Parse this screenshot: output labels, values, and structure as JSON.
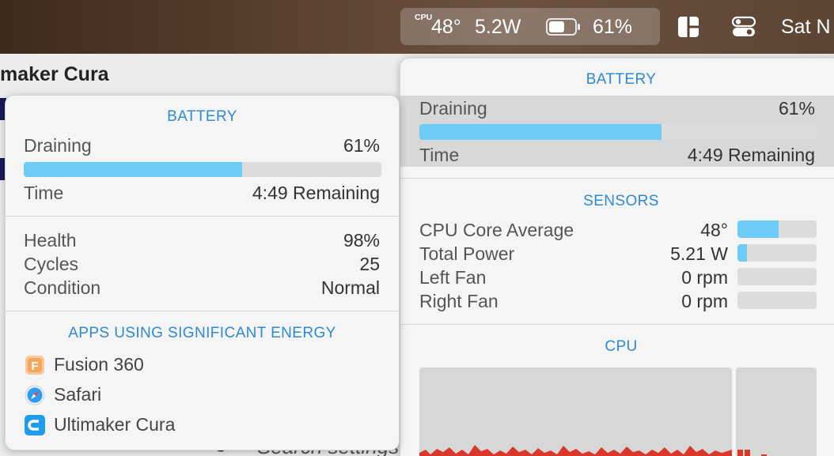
{
  "menubar": {
    "cpu_label": "CPU",
    "cpu_temp": "48°",
    "power": "5.2W",
    "battery_percent": "61%",
    "battery_level": 0.61,
    "clock": "Sat N"
  },
  "background_app": {
    "title": "maker Cura",
    "search_placeholder": "Search settings"
  },
  "left_popover": {
    "battery": {
      "title": "BATTERY",
      "status_label": "Draining",
      "status_value": "61%",
      "level": 0.61,
      "time_label": "Time",
      "time_value": "4:49 Remaining"
    },
    "health": {
      "health_label": "Health",
      "health_value": "98%",
      "cycles_label": "Cycles",
      "cycles_value": "25",
      "condition_label": "Condition",
      "condition_value": "Normal"
    },
    "apps": {
      "title": "APPS USING SIGNIFICANT ENERGY",
      "items": [
        {
          "name": "Fusion 360",
          "icon": "fusion-360-icon"
        },
        {
          "name": "Safari",
          "icon": "safari-icon"
        },
        {
          "name": "Ultimaker Cura",
          "icon": "ultimaker-cura-icon"
        }
      ]
    }
  },
  "right_popover": {
    "battery": {
      "title": "BATTERY",
      "status_label": "Draining",
      "status_value": "61%",
      "level": 0.61,
      "time_label": "Time",
      "time_value": "4:49 Remaining"
    },
    "sensors": {
      "title": "SENSORS",
      "items": [
        {
          "label": "CPU Core Average",
          "value": "48°",
          "level": 0.52
        },
        {
          "label": "Total Power",
          "value": "5.21 W",
          "level": 0.12
        },
        {
          "label": "Left Fan",
          "value": "0 rpm",
          "level": 0
        },
        {
          "label": "Right Fan",
          "value": "0 rpm",
          "level": 0
        }
      ]
    },
    "cpu": {
      "title": "CPU"
    }
  },
  "colors": {
    "accent": "#2d8ad8",
    "bar_fill": "#6ccbf7",
    "bar_track": "#dcdcdc",
    "cpu_graph_user": "#d9372a",
    "cpu_graph_system": "#6b7fd6"
  }
}
